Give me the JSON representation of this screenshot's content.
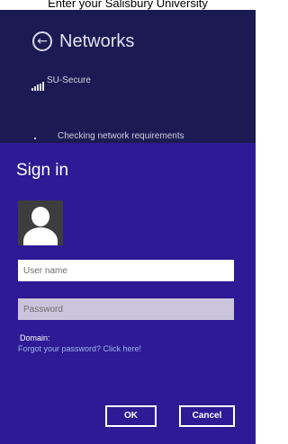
{
  "caption": "Enter your Salisbury University",
  "networks": {
    "title": "Networks",
    "back_glyph": "←",
    "network_name": "SU-Secure",
    "status": "Checking network requirements"
  },
  "signin": {
    "title": "Sign in",
    "username_placeholder": "User name",
    "password_placeholder": "Password",
    "domain_label": "Domain:",
    "forgot_link": "Forgot your password? Click here!",
    "ok_label": "OK",
    "cancel_label": "Cancel"
  },
  "colors": {
    "networks_bg": "#1c1a52",
    "signin_bg": "#2e1a94",
    "link": "#9fb4f0"
  }
}
